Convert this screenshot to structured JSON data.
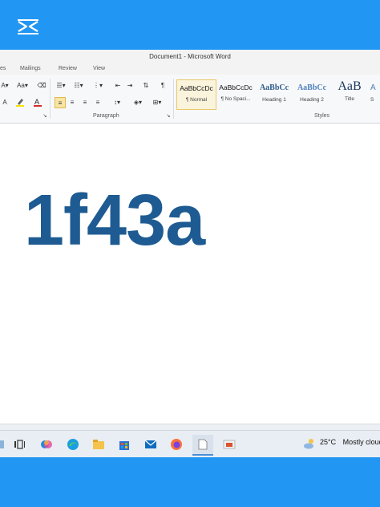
{
  "app": {
    "brand_icon": "capcut-logo-icon"
  },
  "word": {
    "title": "Document1 - Microsoft Word",
    "tabs": [
      "es",
      "Mailings",
      "Review",
      "View"
    ],
    "groups": {
      "paragraph": "Paragraph",
      "styles": "Styles"
    },
    "styles": [
      {
        "sample": "AaBbCcDc",
        "name": "¶ Normal"
      },
      {
        "sample": "AaBbCcDc",
        "name": "¶ No Spaci..."
      },
      {
        "sample": "AaBbCc",
        "name": "Heading 1"
      },
      {
        "sample": "AaBbCc",
        "name": "Heading 2"
      },
      {
        "sample": "AaB",
        "name": "Title"
      },
      {
        "sample": "A",
        "name": "S"
      }
    ],
    "document_text": "1f43a",
    "colors": {
      "heading_text": "#1e5b92",
      "accent_band": "#2196f3"
    }
  },
  "taskbar": {
    "weather_temp": "25°C",
    "weather_desc": "Mostly cloudy"
  }
}
